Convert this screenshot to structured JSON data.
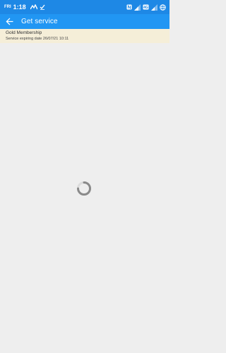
{
  "status_bar": {
    "day": "FRI",
    "time": "1:18",
    "background": "#1e88e5",
    "left_icons": [
      "activity-icon",
      "check-icon"
    ],
    "right_icons": [
      "nfc-icon",
      "signal-icon",
      "volte-icon",
      "signal-icon",
      "globe-icon"
    ]
  },
  "app_bar": {
    "title": "Get service",
    "background": "#2196f3",
    "back_icon": "arrow-back-icon"
  },
  "membership": {
    "name": "Gold Membership",
    "expiry": "Service expiring date 26/07/21 10:11",
    "background": "#f5eed8"
  },
  "content": {
    "state": "loading",
    "background": "#eeeeee"
  }
}
